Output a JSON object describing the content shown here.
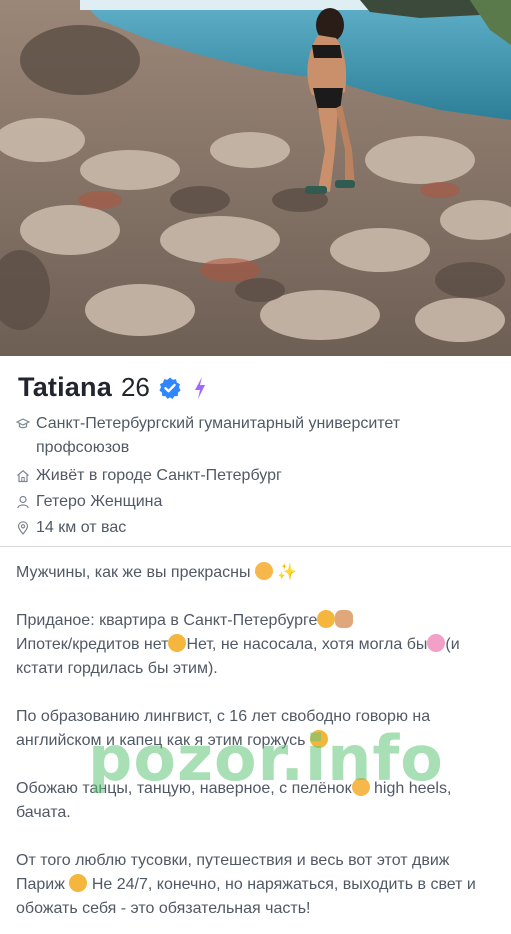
{
  "profile": {
    "name": "Tatiana",
    "age": "26",
    "verified_icon": "verified-badge-icon",
    "boost_icon": "lightning-icon",
    "accent_color": "#a566ff",
    "verified_color": "#2f86ff"
  },
  "details": [
    {
      "icon": "graduation-cap-icon",
      "text": "Санкт-Петербургский гуманитарный университет профсоюзов"
    },
    {
      "icon": "home-icon",
      "text": "Живёт в городе Санкт-Петербург"
    },
    {
      "icon": "person-icon",
      "text": "Гетеро Женщина"
    },
    {
      "icon": "location-pin-icon",
      "text": "14 км от вас"
    }
  ],
  "bio": {
    "line1": "Мужчины, как же вы прекрасны",
    "line2": "Приданое: квартира в Санкт-Петербурге",
    "line3a": "Ипотек/кредитов нет",
    "line3b": "Нет, не насосала, хотя могла бы",
    "line3c": "(и кстати гордилась бы этим).",
    "line4": "По образованию лингвист, с 16 лет свободно говорю на английском и капец как я этим горжусь",
    "line5a": "Обожаю танцы, танцую, наверное, с пелёнок",
    "line5b": " high heels, бачата.",
    "line6a": "От того люблю тусовки, путешествия и весь вот этот движ Париж",
    "line6b": " Не 24/7, конечно, но наряжаться, выходить в свет и обожать себя - это обязательная часть!"
  },
  "watermark": "pozor.info"
}
